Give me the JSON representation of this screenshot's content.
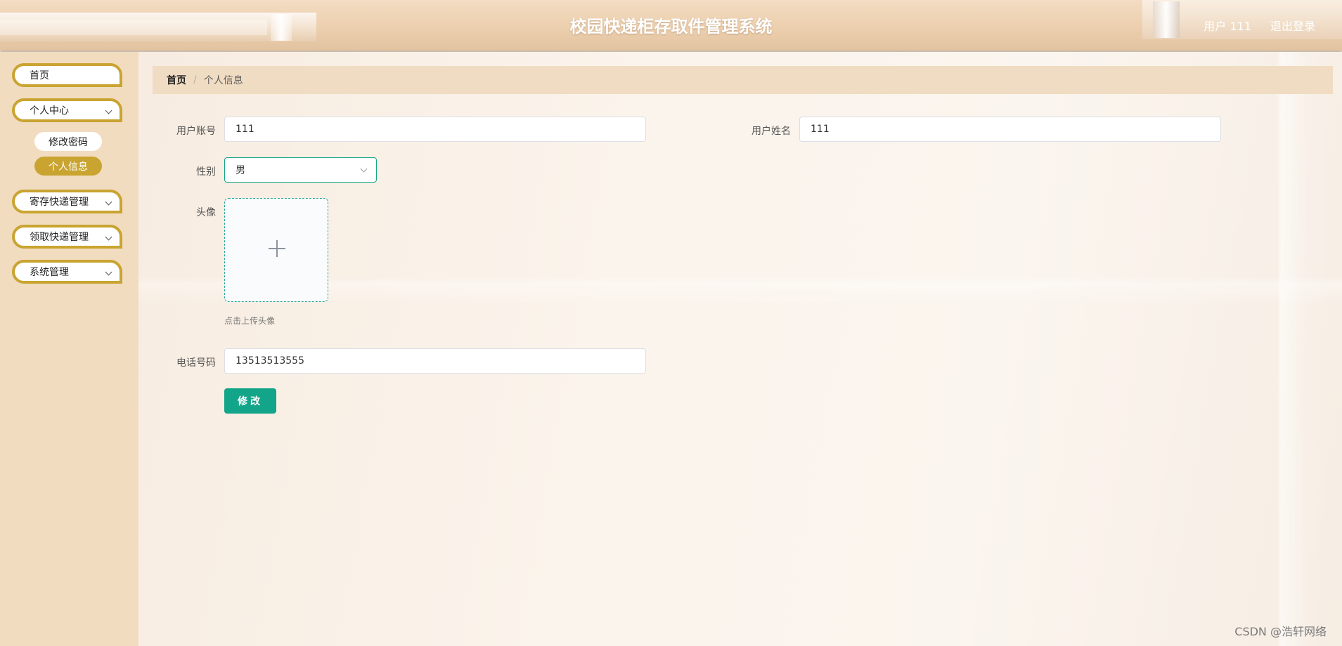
{
  "header": {
    "title": "校园快递柜存取件管理系统",
    "user_label": "用户 111",
    "logout": "退出登录"
  },
  "sidebar": {
    "items": [
      {
        "label": "首页"
      },
      {
        "label": "个人中心",
        "children": [
          {
            "label": "修改密码"
          },
          {
            "label": "个人信息",
            "active": true
          }
        ]
      },
      {
        "label": "寄存快递管理"
      },
      {
        "label": "领取快递管理"
      },
      {
        "label": "系统管理"
      }
    ]
  },
  "breadcrumb": {
    "home": "首页",
    "separator": "/",
    "current": "个人信息"
  },
  "form": {
    "account_label": "用户账号",
    "account_value": "111",
    "name_label": "用户姓名",
    "name_value": "111",
    "gender_label": "性别",
    "gender_value": "男",
    "avatar_label": "头像",
    "avatar_tip": "点击上传头像",
    "phone_label": "电话号码",
    "phone_value": "13513513555",
    "submit_label": "修改"
  },
  "watermark": "CSDN @浩轩网络",
  "colors": {
    "accent_gold": "#c9a430",
    "primary_green": "#13a58a",
    "sidebar_bg": "#f1dcc0",
    "breadcrumb_bg": "#f0dcc2"
  }
}
